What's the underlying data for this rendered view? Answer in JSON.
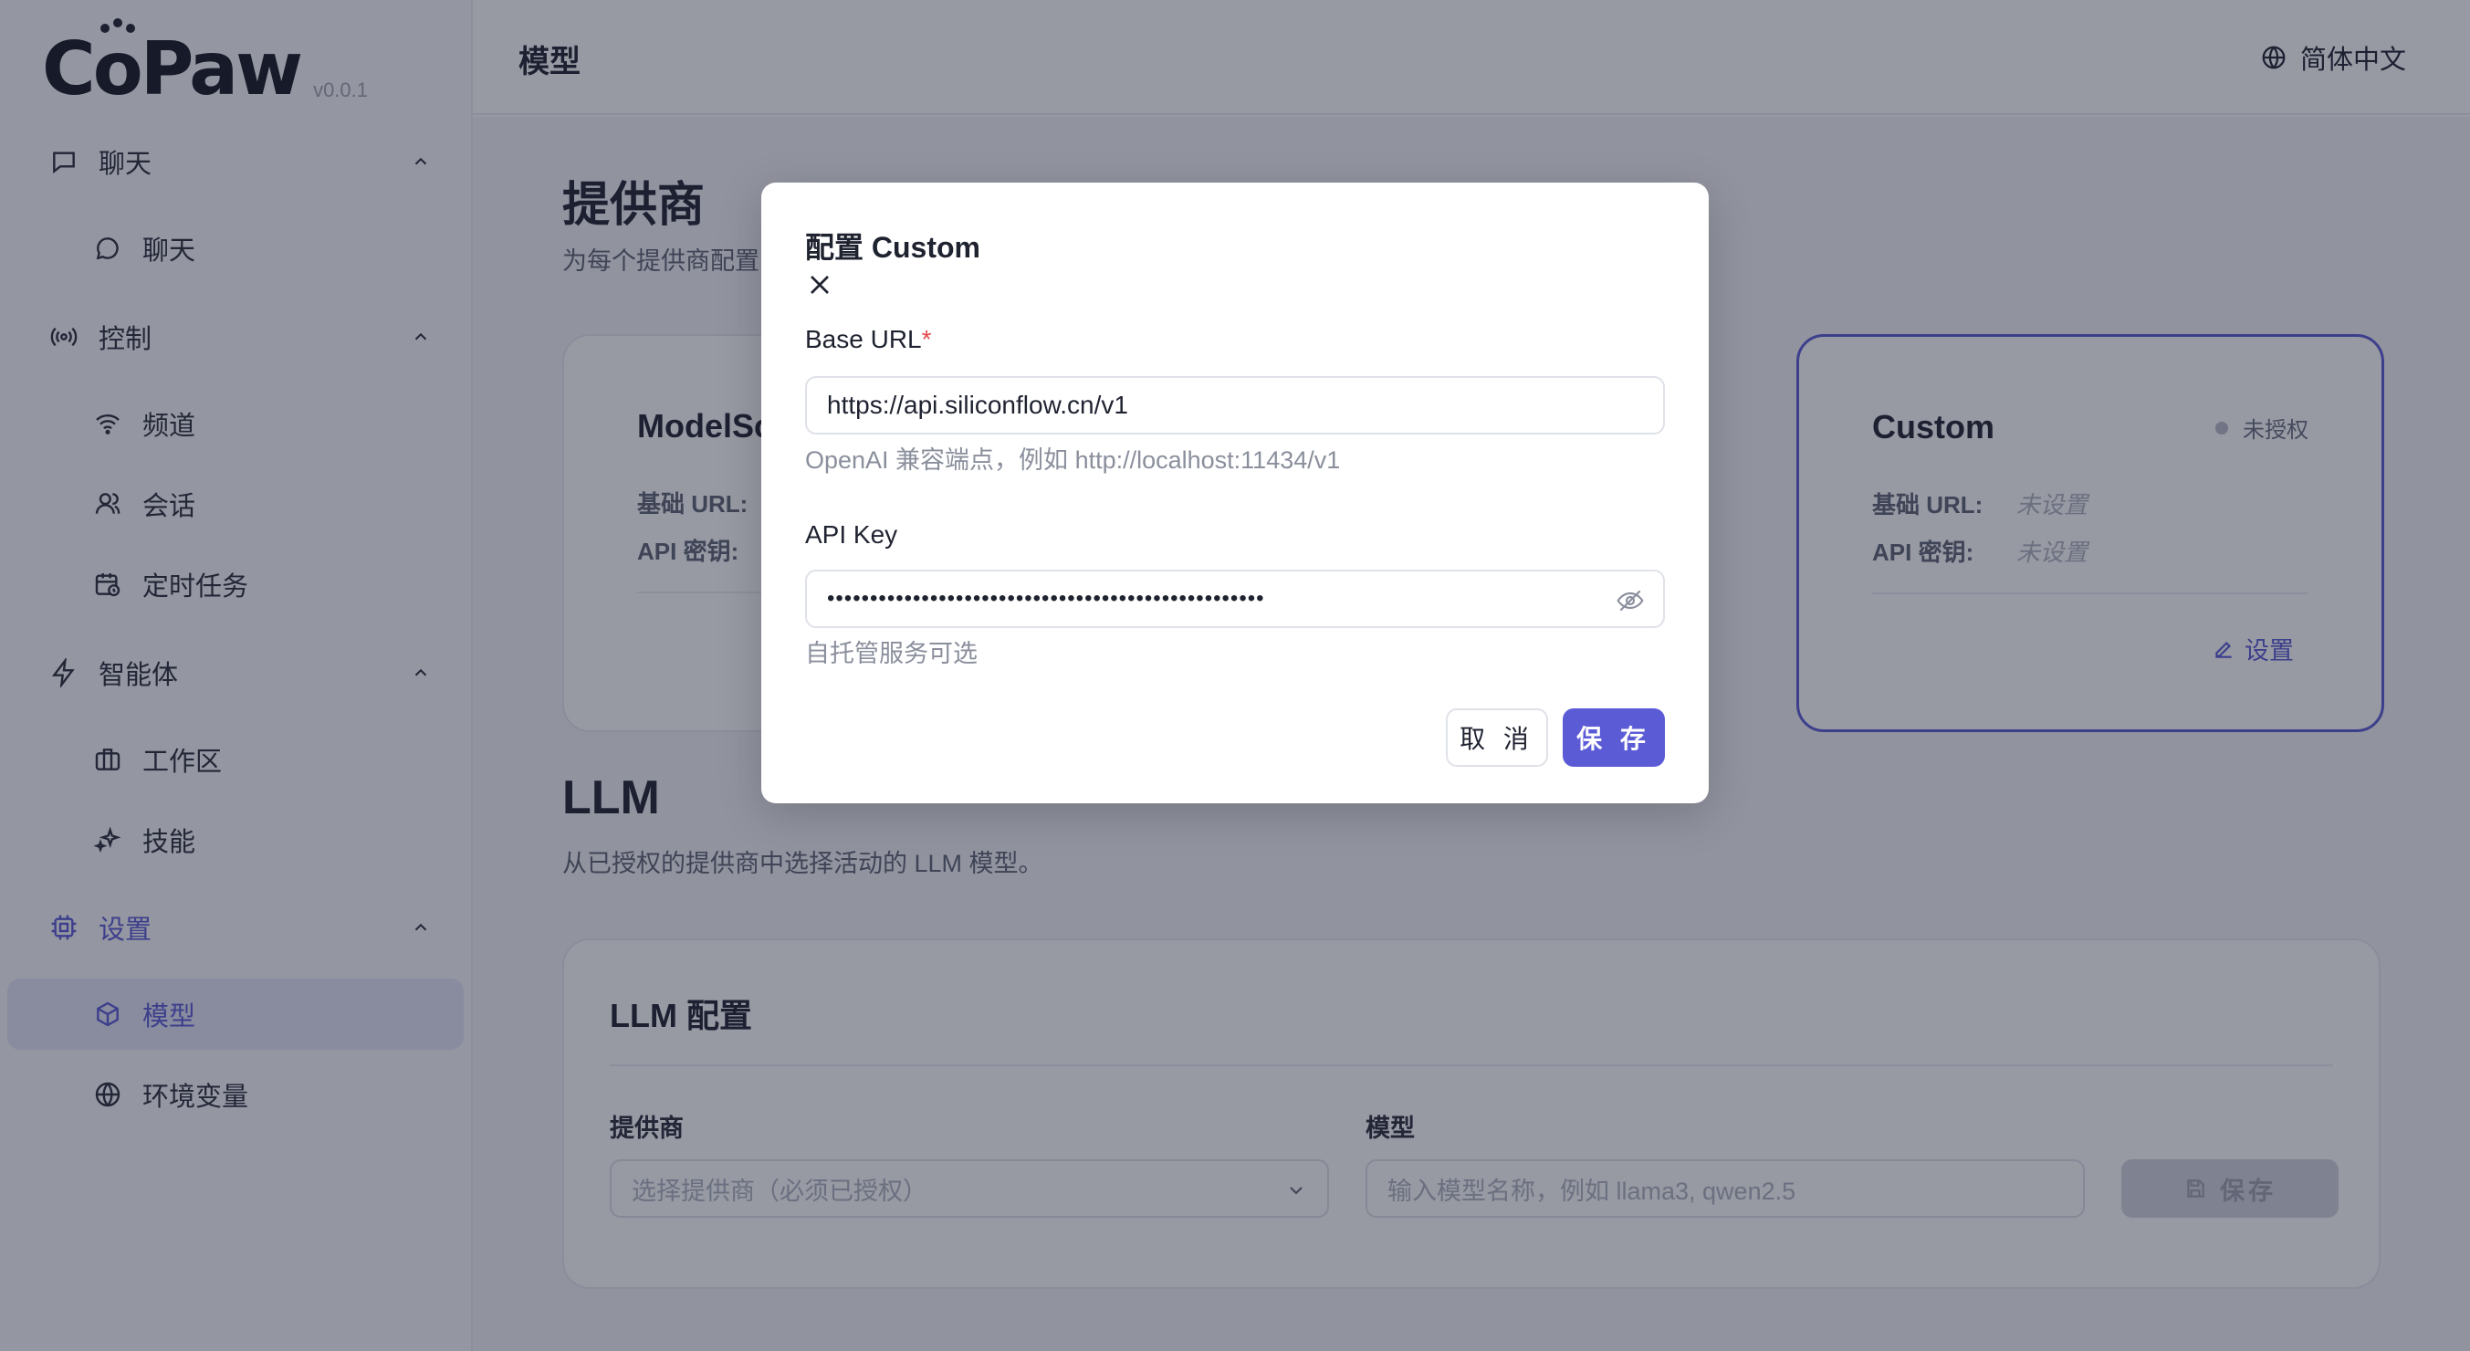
{
  "logo": {
    "text_pre": "C",
    "text_o": "o",
    "text_post": "Paw",
    "version": "v0.0.1"
  },
  "header": {
    "title": "模型",
    "language": "简体中文"
  },
  "sidebar": {
    "groups": [
      {
        "label": "聊天",
        "items": [
          {
            "label": "聊天"
          }
        ]
      },
      {
        "label": "控制",
        "items": [
          {
            "label": "频道"
          },
          {
            "label": "会话"
          },
          {
            "label": "定时任务"
          }
        ]
      },
      {
        "label": "智能体",
        "items": [
          {
            "label": "工作区"
          },
          {
            "label": "技能"
          }
        ]
      },
      {
        "label": "设置",
        "items": [
          {
            "label": "模型"
          },
          {
            "label": "环境变量"
          }
        ]
      }
    ]
  },
  "providers": {
    "title": "提供商",
    "desc": "为每个提供商配置",
    "cards": [
      {
        "name": "ModelSc",
        "base_url_label": "基础 URL:",
        "api_key_label": "API 密钥:"
      },
      {
        "name": "Custom",
        "status": "未授权",
        "base_url_label": "基础 URL:",
        "base_url_value": "未设置",
        "api_key_label": "API 密钥:",
        "api_key_value": "未设置",
        "action": "设置"
      }
    ]
  },
  "llm": {
    "title": "LLM",
    "desc": "从已授权的提供商中选择活动的 LLM 模型。",
    "card_title": "LLM 配置",
    "provider_label": "提供商",
    "provider_placeholder": "选择提供商（必须已授权）",
    "model_label": "模型",
    "model_placeholder": "输入模型名称，例如 llama3, qwen2.5",
    "save_label": "保存"
  },
  "modal": {
    "title": "配置 Custom",
    "base_url_label": "Base URL",
    "required_mark": "*",
    "base_url_value": "https://api.siliconflow.cn/v1",
    "base_url_hint": "OpenAI 兼容端点，例如 http://localhost:11434/v1",
    "api_key_label": "API Key",
    "api_key_value": "•••••••••••••••••••••••••••••••••••••••••••••••••••",
    "api_key_hint": "自托管服务可选",
    "cancel_label": "取 消",
    "save_label": "保 存"
  },
  "colors": {
    "accent": "#5b5bd6",
    "required": "#e5484d"
  }
}
